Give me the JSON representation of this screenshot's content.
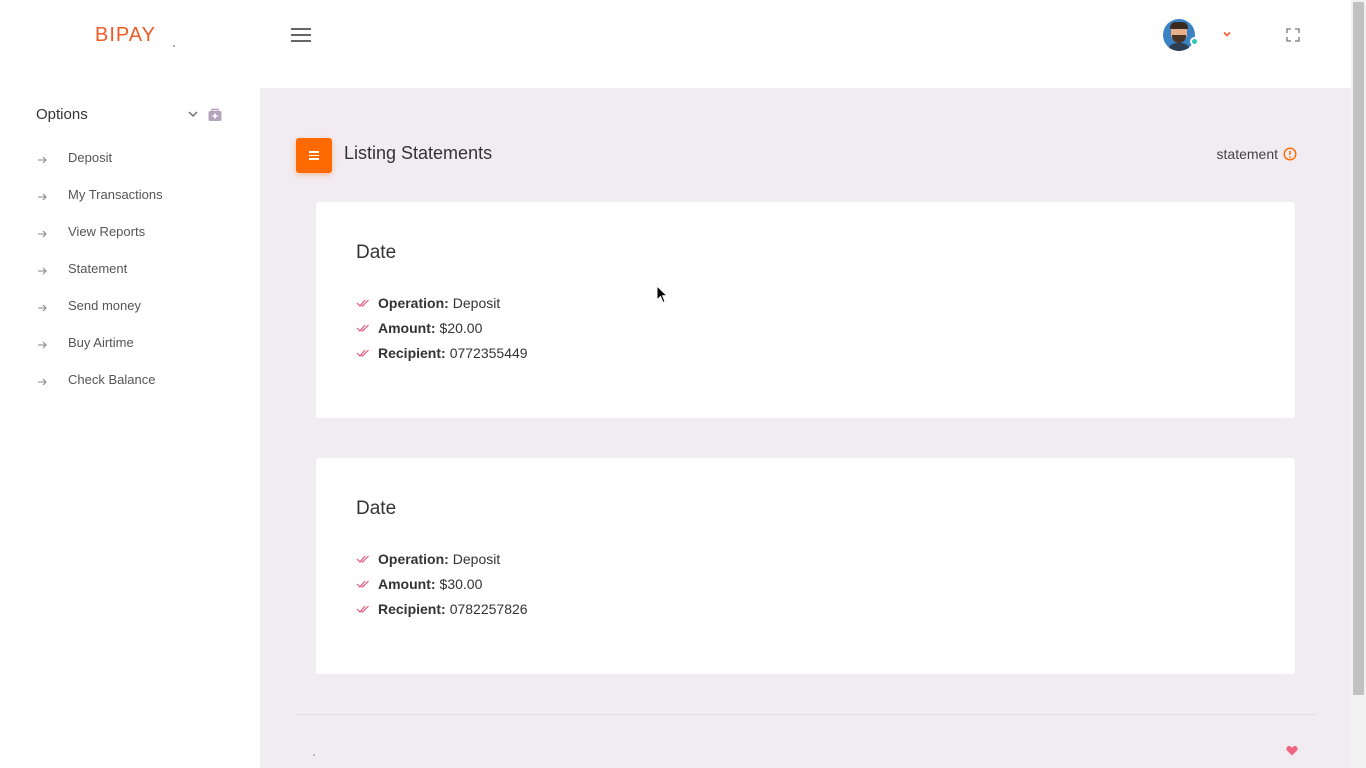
{
  "header": {
    "logo": "BIPAY",
    "icons": {
      "menu": "hamburger-icon",
      "user_caret": "chevron-down-icon",
      "fullscreen": "fullscreen-icon"
    }
  },
  "sidebar": {
    "section_title": "Options",
    "items": [
      {
        "label": "Deposit"
      },
      {
        "label": "My Transactions"
      },
      {
        "label": "View Reports"
      },
      {
        "label": "Statement"
      },
      {
        "label": "Send money"
      },
      {
        "label": "Buy Airtime"
      },
      {
        "label": "Check Balance"
      }
    ]
  },
  "main": {
    "page_title": "Listing Statements",
    "breadcrumb": "statement",
    "statements": [
      {
        "title": "Date",
        "operation_label": "Operation:",
        "operation": "Deposit",
        "amount_label": "Amount:",
        "amount": "$20.00",
        "recipient_label": "Recipient:",
        "recipient": "0772355449"
      },
      {
        "title": "Date",
        "operation_label": "Operation:",
        "operation": "Deposit",
        "amount_label": "Amount:",
        "amount": "$30.00",
        "recipient_label": "Recipient:",
        "recipient": "0782257826"
      }
    ]
  },
  "colors": {
    "accent": "#ff6a00",
    "logo": "#f15a24",
    "content_bg": "#f1ecf2",
    "check": "#e8577a",
    "online": "#2ec4b6"
  }
}
